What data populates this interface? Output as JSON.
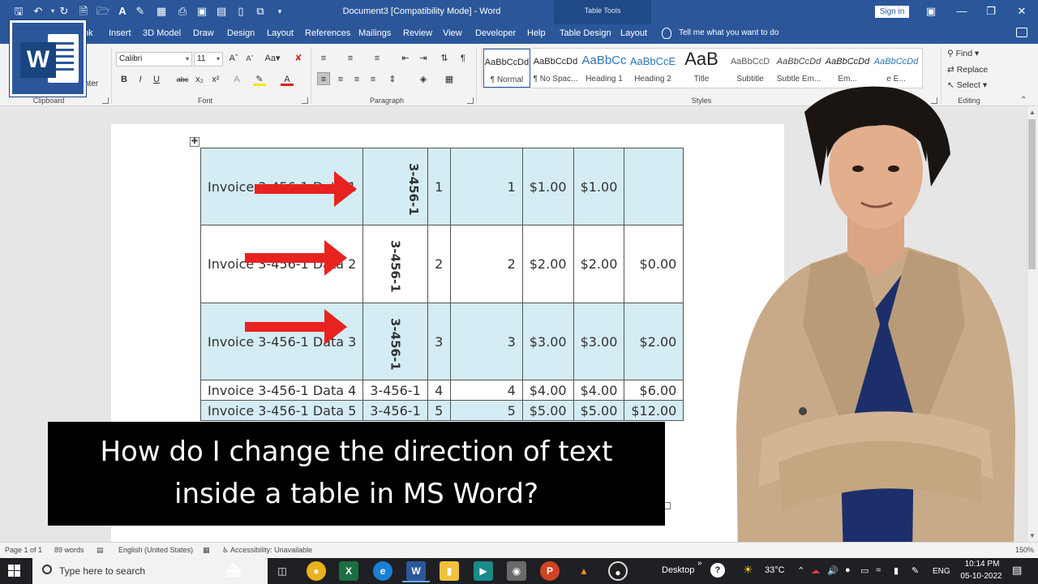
{
  "titlebar": {
    "doc_title": "Document3 [Compatibility Mode]  -  Word",
    "table_tools": "Table Tools",
    "signin": "Sign in"
  },
  "tabs": [
    "nk",
    "Insert",
    "3D Model",
    "Draw",
    "Design",
    "Layout",
    "References",
    "Mailings",
    "Review",
    "View",
    "Developer",
    "Help",
    "Table Design",
    "Layout"
  ],
  "tellme": "Tell me what you want to do",
  "ribbon": {
    "clipboard": {
      "label": "Clipboard",
      "painter_text": "nter"
    },
    "font": {
      "label": "Font",
      "name": "Calibri",
      "size": "11"
    },
    "paragraph": {
      "label": "Paragraph"
    },
    "styles": {
      "label": "Styles",
      "items": [
        {
          "sample": "AaBbCcDd",
          "name": "¶ Normal"
        },
        {
          "sample": "AaBbCcDd",
          "name": "¶ No Spac..."
        },
        {
          "sample": "AaBbCc",
          "name": "Heading 1"
        },
        {
          "sample": "AaBbCcE",
          "name": "Heading 2"
        },
        {
          "sample": "AaB",
          "name": "Title"
        },
        {
          "sample": "AaBbCcD",
          "name": "Subtitle"
        },
        {
          "sample": "AaBbCcDd",
          "name": "Subtle Em..."
        },
        {
          "sample": "AaBbCcDd",
          "name": "Em..."
        },
        {
          "sample": "AaBbCcDd",
          "name": "e E..."
        }
      ]
    },
    "editing": {
      "label": "Editing",
      "find": "Find",
      "replace": "Replace",
      "select": "Select"
    }
  },
  "document": {
    "rows": [
      {
        "c1": "Invoice 3-456-1 Data 1",
        "c2": "3-456-1",
        "c3": "1",
        "c4": "1",
        "c5": "$1.00",
        "c6": "$1.00",
        "c7": ""
      },
      {
        "c1": "Invoice 3-456-1 Data 2",
        "c2": "3-456-1",
        "c3": "2",
        "c4": "2",
        "c5": "$2.00",
        "c6": "$2.00",
        "c7": "$0.00"
      },
      {
        "c1": "Invoice 3-456-1 Data 3",
        "c2": "3-456-1",
        "c3": "3",
        "c4": "3",
        "c5": "$3.00",
        "c6": "$3.00",
        "c7": "$2.00"
      },
      {
        "c1": "Invoice 3-456-1 Data 4",
        "c2": "3-456-1",
        "c3": "4",
        "c4": "4",
        "c5": "$4.00",
        "c6": "$4.00",
        "c7": "$6.00"
      },
      {
        "c1": "Invoice 3-456-1 Data 5",
        "c2": "3-456-1",
        "c3": "5",
        "c4": "5",
        "c5": "$5.00",
        "c6": "$5.00",
        "c7": "$12.00"
      }
    ]
  },
  "caption": {
    "line1": "How do I change the direction of text",
    "line2": "inside a table in MS Word?"
  },
  "statusbar": {
    "page": "Page 1 of 1",
    "words": "89 words",
    "language": "English (United States)",
    "accessibility": "Accessibility: Unavailable",
    "zoom": "150%"
  },
  "taskbar": {
    "search_placeholder": "Type here to search",
    "desktop": "Desktop",
    "weather": "33°C",
    "lang": "ENG",
    "time": "10:14 PM",
    "date": "05-10-2022"
  },
  "colors": {
    "word_blue": "#2b579a",
    "table_shade": "#d4ecf3",
    "arrow_red": "#e8231f"
  }
}
